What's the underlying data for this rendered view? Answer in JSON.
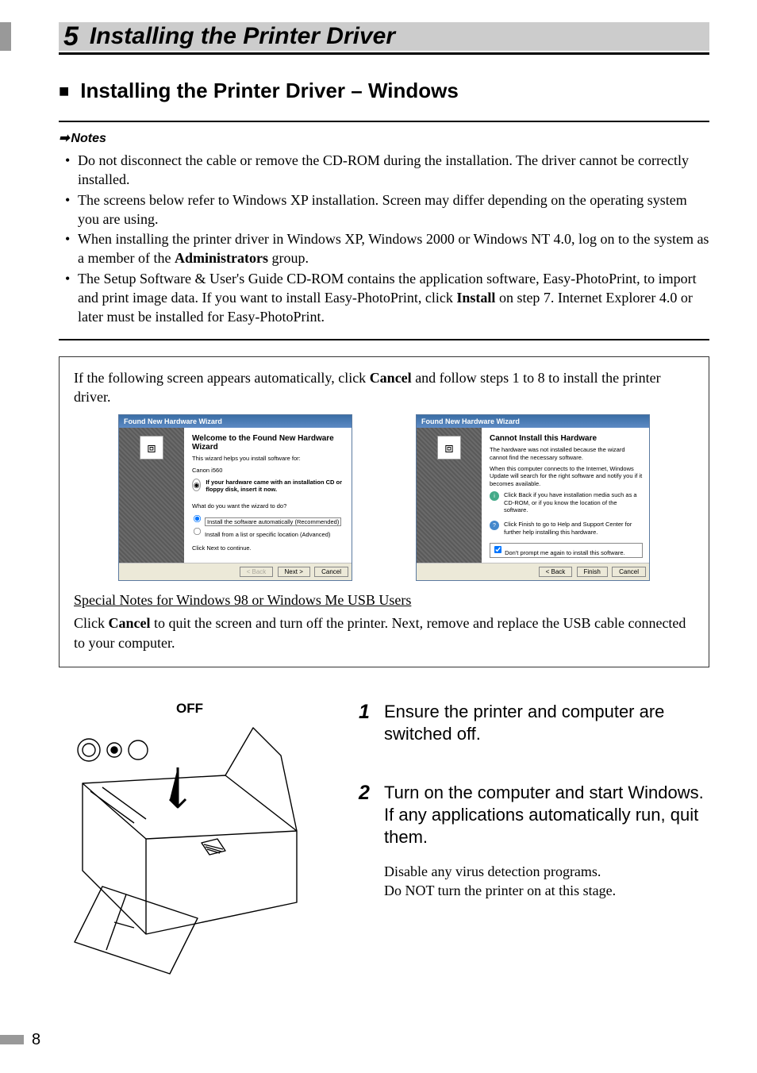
{
  "chapter": {
    "number": "5",
    "title": "Installing the Printer Driver"
  },
  "section": {
    "bullet": "■",
    "title": "Installing the Printer Driver – Windows"
  },
  "notes": {
    "heading_arrow": "➡",
    "heading": "Notes",
    "items": [
      {
        "text": "Do not disconnect the cable or remove the CD-ROM during the installation. The driver cannot be correctly installed."
      },
      {
        "text": "The screens below refer to Windows XP installation. Screen may differ depending on the operating system you are using."
      },
      {
        "pre": "When installing the printer driver in Windows XP, Windows 2000 or Windows NT 4.0, log on to the system as a member of the ",
        "bold": "Administrators",
        "post": " group."
      },
      {
        "pre": "The Setup Software & User's Guide CD-ROM contains the application software, Easy-PhotoPrint, to import and print image data. If you want to install Easy-PhotoPrint, click ",
        "bold": "Install",
        "post": " on step 7. Internet Explorer 4.0 or later must be installed for Easy-PhotoPrint."
      }
    ]
  },
  "callout": {
    "sentence_pre": "If the following screen appears automatically, click ",
    "sentence_bold": "Cancel",
    "sentence_post": " and follow steps 1 to 8 to install the printer driver.",
    "dialog1": {
      "title": "Found New Hardware Wizard",
      "heading": "Welcome to the Found New Hardware Wizard",
      "line1": "This wizard helps you install software for:",
      "device": "Canon i560",
      "cd_text": "If your hardware came with an installation CD or floppy disk, insert it now.",
      "question": "What do you want the wizard to do?",
      "opt1": "Install the software automatically (Recommended)",
      "opt2": "Install from a list or specific location (Advanced)",
      "continue": "Click Next to continue.",
      "btn_back": "< Back",
      "btn_next": "Next >",
      "btn_cancel": "Cancel"
    },
    "dialog2": {
      "title": "Found New Hardware Wizard",
      "heading": "Cannot Install this Hardware",
      "line1": "The hardware was not installed because the wizard cannot find the necessary software.",
      "line2": "When this computer connects to the Internet, Windows Update will search for the right software and notify you if it becomes available.",
      "tip1": "Click Back if you have installation media such as a CD-ROM, or if you know the location of the software.",
      "tip2": "Click Finish to go to Help and Support Center for further help installing this hardware.",
      "checkbox": "Don't prompt me again to install this software.",
      "btn_back": "< Back",
      "btn_finish": "Finish",
      "btn_cancel": "Cancel"
    },
    "special_heading": "Special Notes for Windows 98 or Windows Me USB Users",
    "special_body_pre": "Click ",
    "special_body_bold": "Cancel",
    "special_body_post": " to quit the screen and turn off the printer. Next, remove and replace the USB cable connected to your computer."
  },
  "lower": {
    "off_label": "OFF",
    "steps": [
      {
        "n": "1",
        "main": "Ensure the printer and computer are switched off."
      },
      {
        "n": "2",
        "main": "Turn on the computer and start Windows. If any applications automatically run, quit them.",
        "sub1": "Disable any virus detection programs.",
        "sub2": "Do NOT turn the printer on at this stage."
      }
    ]
  },
  "page_number": "8"
}
